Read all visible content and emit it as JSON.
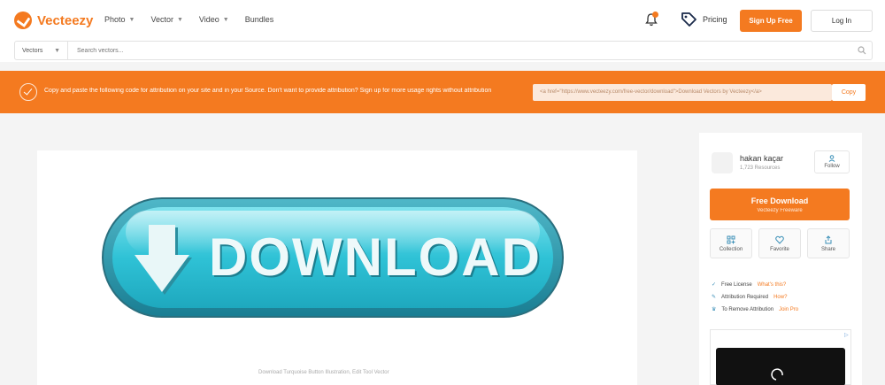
{
  "brand": {
    "name": "Vecteezy",
    "accent": "#f47a20"
  },
  "nav": {
    "items": [
      "Photo",
      "Vector",
      "Video",
      "Bundles"
    ],
    "pricing_label": "Pricing",
    "signup_label": "Sign Up Free",
    "login_label": "Log In"
  },
  "search": {
    "category": "Vectors",
    "placeholder": "Search vectors..."
  },
  "banner": {
    "message": "Copy and paste the following code for attribution on your site and in your Source. Don't want to provide attribution? Sign up for more usage rights without attribution",
    "attribution_code": "<a href=\"https://www.vecteezy.com/free-vector/download\">Download Vectors by Vecteezy</a>",
    "copy_label": "Copy"
  },
  "preview": {
    "button_text": "DOWNLOAD",
    "caption": "Download Turquoise Button Illustration, Edit Tool Vector"
  },
  "sidebar": {
    "author_name": "hakan kaçar",
    "author_count": "1,723 Resources",
    "follow_label": "Follow",
    "download_label": "Free Download",
    "download_sub": "Vecteezy Freeware",
    "actions": [
      "Collection",
      "Favorite",
      "Share"
    ],
    "license": [
      {
        "text": "Free License",
        "tag": "What's this?"
      },
      {
        "text": "Attribution Required",
        "tag": "How?"
      },
      {
        "text": "To Remove Attribution",
        "tag": "Join Pro"
      }
    ],
    "ad_marker": "▷"
  }
}
